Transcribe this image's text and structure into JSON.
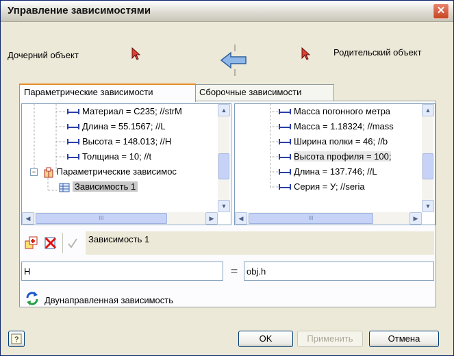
{
  "window": {
    "title": "Управление зависимостями"
  },
  "header": {
    "child_label": "Дочерний объект",
    "parent_label": "Родительский объект"
  },
  "tabs": [
    {
      "label": "Параметрические зависимости",
      "active": true
    },
    {
      "label": "Сборочные зависимости",
      "active": false
    }
  ],
  "left_tree": {
    "items": [
      {
        "text": "Материал = C235; //strM"
      },
      {
        "text": "Длина = 55.1567; //L"
      },
      {
        "text": "Высота = 148.013; //H"
      },
      {
        "text": "Толщина = 10; //t"
      },
      {
        "text": "Параметрические зависимос"
      },
      {
        "text": "Зависимость 1",
        "selected": true
      }
    ],
    "scroll_symbol": "III"
  },
  "right_tree": {
    "items": [
      {
        "text": "Масса погонного метра"
      },
      {
        "text": "Масса = 1.18324; //mass"
      },
      {
        "text": "Ширина полки = 46; //b"
      },
      {
        "text": "Высота профиля = 100;"
      },
      {
        "text": "Длина = 137.746; //L"
      },
      {
        "text": "Серия = У; //seria"
      }
    ],
    "scroll_symbol": "III"
  },
  "dependency": {
    "name": "Зависимость 1",
    "left_expr": "H",
    "equals": "=",
    "right_expr": "obj.h",
    "bidirectional_label": "Двунаправленная зависимость"
  },
  "buttons": {
    "ok": "OK",
    "apply": "Применить",
    "cancel": "Отмена"
  },
  "icons": {
    "close": "close-icon",
    "pick": "cursor-pick-icon",
    "direction": "arrow-left-icon",
    "add": "add-dependency-icon",
    "delete": "delete-dependency-icon",
    "apply": "checkmark-icon",
    "bidirectional": "refresh-icon",
    "help": "help-icon"
  }
}
